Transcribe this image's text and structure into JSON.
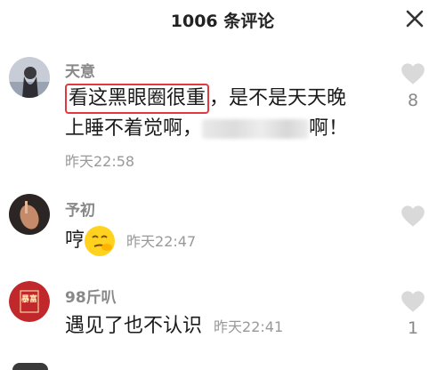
{
  "header": {
    "title": "1006 条评论",
    "close_icon": "close-icon"
  },
  "comments": [
    {
      "author": "天意",
      "text_highlighted": "看这黑眼圈很重",
      "text_line1_rest": "，是不是天天晚",
      "text_line2_start": "上睡不着觉啊，",
      "text_line2_end": "啊！",
      "time": "昨天22:58",
      "likes": "8"
    },
    {
      "author": "予初",
      "text": "哼",
      "time": "昨天22:47",
      "likes": ""
    },
    {
      "author": "98斤叭",
      "avatar_text": "暴富",
      "text": "遇见了也不认识",
      "time": "昨天22:41",
      "likes": "1"
    }
  ],
  "colors": {
    "highlight_border": "#e0393e",
    "like_icon": "#d9d9d9"
  }
}
